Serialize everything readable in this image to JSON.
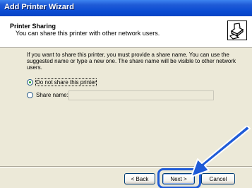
{
  "window": {
    "title": "Add Printer Wizard"
  },
  "header": {
    "heading": "Printer Sharing",
    "subheading": "You can share this printer with other network users.",
    "icon": "printer-hand-icon"
  },
  "content": {
    "description": "If you want to share this printer, you must provide a share name. You can use the suggested name or type a new one. The share name will be visible to other network users.",
    "options": [
      {
        "label": "Do not share this printer",
        "selected": true
      },
      {
        "label": "Share name:",
        "selected": false
      }
    ],
    "share_name_value": ""
  },
  "buttons": {
    "back": "< Back",
    "next": "Next >",
    "cancel": "Cancel"
  },
  "colors": {
    "titlebar": "#0a4bd2",
    "highlight": "#1f5bd7",
    "dialog_bg": "#ece9d8"
  }
}
